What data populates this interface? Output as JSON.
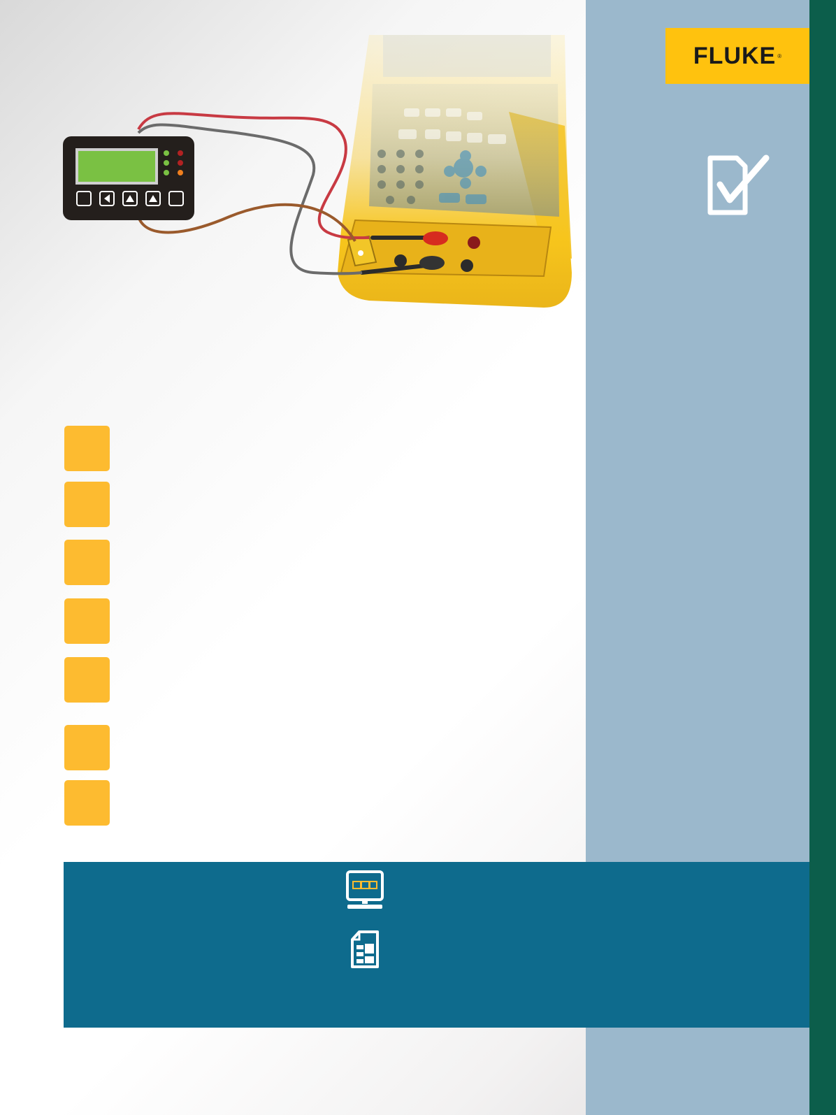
{
  "brand": {
    "logo_text": "FLUKE",
    "registered_mark": "®",
    "logo_color": "#ffc20e"
  },
  "colors": {
    "accent_yellow": "#fdbb30",
    "panel_blue": "#9bb8cc",
    "band_teal": "#0e6b8d",
    "strip_green": "#0c5e4b"
  },
  "icons": {
    "checklist": "checklist-icon",
    "monitor": "monitor-icon",
    "document": "document-icon"
  },
  "steps": [
    {
      "marker": "step-1"
    },
    {
      "marker": "step-2"
    },
    {
      "marker": "step-3"
    },
    {
      "marker": "step-4"
    },
    {
      "marker": "step-5"
    },
    {
      "marker": "step-6"
    },
    {
      "marker": "step-7"
    }
  ]
}
